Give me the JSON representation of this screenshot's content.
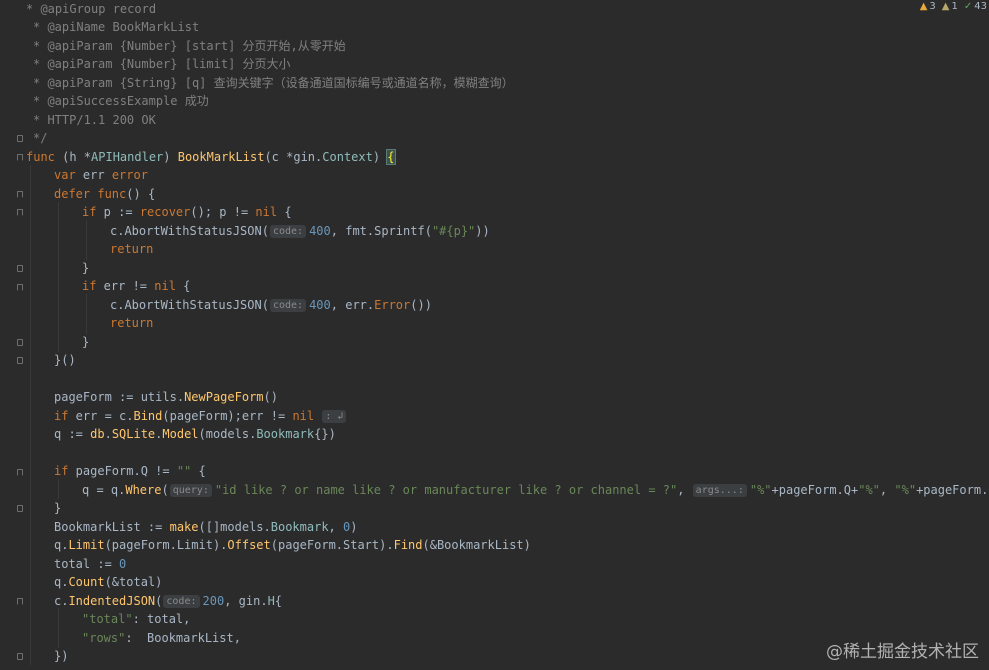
{
  "inspections": {
    "warnings": "3",
    "weak_warnings": "1",
    "typos": "43"
  },
  "code": {
    "l0": [
      "* @apiGroup record"
    ],
    "l1": [
      "* @apiName BookMarkList"
    ],
    "l2": [
      "* @apiParam {Number} [start] 分页开始,从零开始"
    ],
    "l3": [
      "* @apiParam {Number} [limit] 分页大小"
    ],
    "l4": [
      "* @apiParam {String} [q] 查询关键字（设备通道国标编号或通道名称，模糊查询）"
    ],
    "l5": [
      "* @apiSuccessExample 成功"
    ],
    "l6": [
      "* HTTP/1.1 200 OK"
    ],
    "l7": [
      "*/"
    ],
    "l8": [
      "func",
      " (h *",
      "APIHandler",
      ") ",
      "BookMarkList",
      "(c *",
      "gin",
      ".",
      "Context",
      ") ",
      "{"
    ],
    "l9": [
      "var",
      " err ",
      "error"
    ],
    "l10": [
      "defer",
      " ",
      "func",
      "() {"
    ],
    "l11": [
      "if",
      " p := ",
      "recover",
      "(); p != ",
      "nil",
      " {"
    ],
    "l12": [
      "c.",
      "AbortWithStatusJSON",
      "(",
      "code:",
      "400",
      ", fmt.",
      "Sprintf",
      "(",
      "\"#{p}\"",
      "))"
    ],
    "l13": [
      "return"
    ],
    "l14": [
      "}"
    ],
    "l15": [
      "if",
      " err != ",
      "nil",
      " {"
    ],
    "l16": [
      "c.",
      "AbortWithStatusJSON",
      "(",
      "code:",
      "400",
      ", err.",
      "Error",
      "())"
    ],
    "l17": [
      "return"
    ],
    "l18": [
      "}"
    ],
    "l19": [
      "}()"
    ],
    "l21": [
      "pageForm := ",
      "utils",
      ".",
      "NewPageForm",
      "()"
    ],
    "l22": [
      "if",
      " err = c.",
      "Bind",
      "(pageForm);err != ",
      "nil",
      " ",
      ": ↲"
    ],
    "l23": [
      "q := ",
      "db",
      ".",
      "SQLite",
      ".",
      "Model",
      "(models.",
      "Bookmark",
      "{})"
    ],
    "l25": [
      "if",
      " pageForm.Q != ",
      "\"\"",
      " {"
    ],
    "l26": [
      "q = q.",
      "Where",
      "(",
      "query:",
      "\"id like ? or name like ? or manufacturer like ? or channel = ?\"",
      ", ",
      "args...:",
      "\"%\"",
      "+pageForm.Q+",
      "\"%\"",
      ", ",
      "\"%\"",
      "+pageForm.Q+",
      "\"%\""
    ],
    "l27": [
      "}"
    ],
    "l28": [
      "BookmarkList := ",
      "make",
      "([]models.",
      "Bookmark",
      ", ",
      "0",
      ")"
    ],
    "l29": [
      "q.",
      "Limit",
      "(pageForm.Limit).",
      "Offset",
      "(pageForm.Start).",
      "Find",
      "(&BookmarkList)"
    ],
    "l30": [
      "total := ",
      "0"
    ],
    "l31": [
      "q.",
      "Count",
      "(&total)"
    ],
    "l32": [
      "c.",
      "IndentedJSON",
      "(",
      "code:",
      "200",
      ", ",
      "gin",
      ".",
      "H",
      "{"
    ],
    "l33": [
      "\"total\"",
      ": total,"
    ],
    "l34": [
      "\"rows\"",
      ":  BookmarkList,"
    ],
    "l35": [
      "})"
    ]
  },
  "watermark": "@稀土掘金技术社区"
}
